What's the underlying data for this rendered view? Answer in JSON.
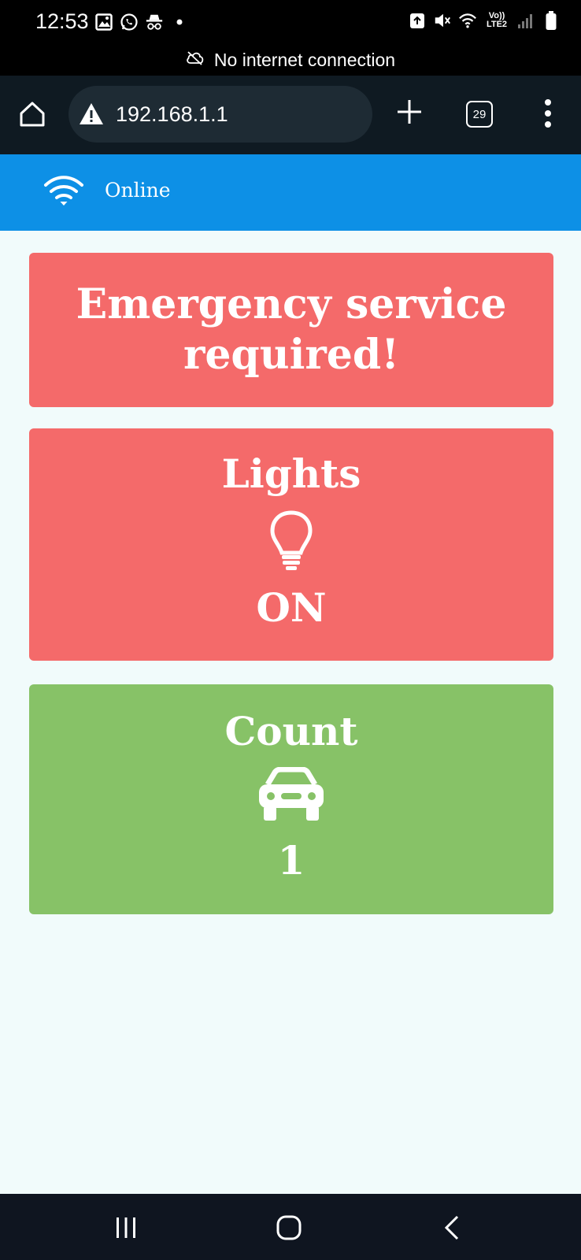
{
  "status_bar": {
    "time": "12:53",
    "network_label": "Vo)) LTE2",
    "left_icons": [
      "gallery-icon",
      "whatsapp-icon",
      "incognito-icon",
      "dot-icon"
    ],
    "right_icons": [
      "battery-saver-icon",
      "mute-icon",
      "wifi-icon",
      "signal-icon",
      "battery-icon"
    ]
  },
  "offline_notice": {
    "text": "No internet connection",
    "icon": "cloud-off-icon"
  },
  "browser": {
    "url": "192.168.1.1",
    "security_icon": "warning-icon",
    "tab_count": "29"
  },
  "page": {
    "header": {
      "status": "Online",
      "icon": "wifi-icon",
      "color": "#0d90e6"
    },
    "alert": {
      "text": "Emergency service required!",
      "color": "#f46a6a"
    },
    "lights": {
      "title": "Lights",
      "value": "ON",
      "icon": "lightbulb-icon",
      "color": "#f46a6a"
    },
    "count": {
      "title": "Count",
      "value": "1",
      "icon": "car-icon",
      "color": "#87c267"
    }
  },
  "navigation": {
    "buttons": [
      "recent-apps",
      "home",
      "back"
    ]
  }
}
